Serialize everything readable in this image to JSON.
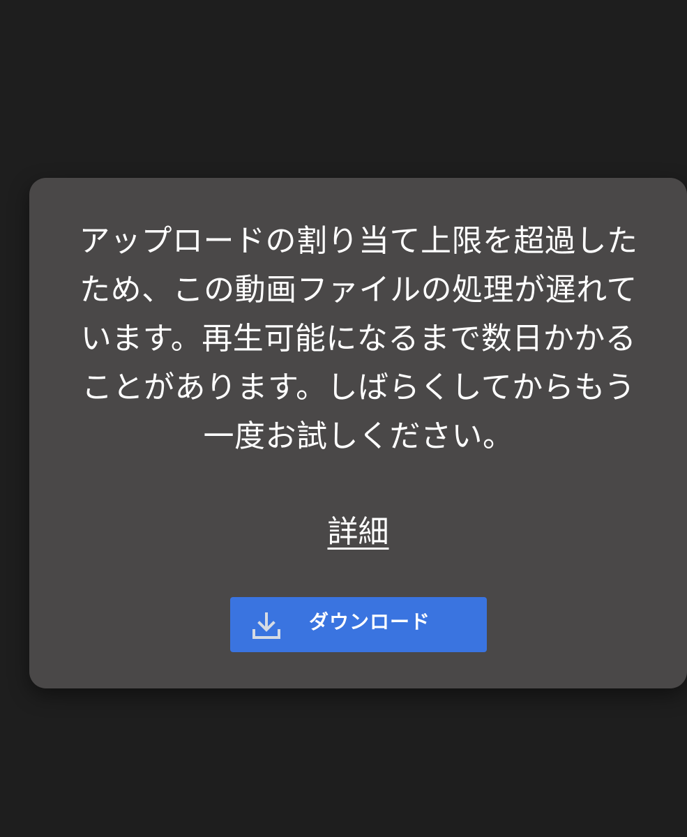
{
  "dialog": {
    "message": "アップロードの割り当て上限を超過したため、この動画ファイルの処理が遅れています。再生可能になるまで数日かかることがあります。しばらくしてからもう一度お試しください。",
    "details_link": "詳細",
    "download_button": {
      "label": "ダウンロード",
      "icon": "download-icon"
    }
  },
  "colors": {
    "background": "#1e1e1e",
    "dialog": "#4a4848",
    "button": "#3a74e0",
    "text": "#ffffff"
  }
}
